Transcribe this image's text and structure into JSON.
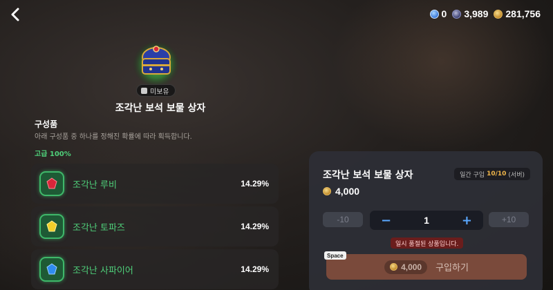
{
  "currency": {
    "items": [
      {
        "icon": "blue-gem-icon",
        "value": "0"
      },
      {
        "icon": "dark-gem-icon",
        "value": "3,989"
      },
      {
        "icon": "gold-coin-icon",
        "value": "281,756"
      }
    ]
  },
  "item": {
    "ownership_tag": "미보유",
    "title": "조각난 보석 보물 상자"
  },
  "contents": {
    "title": "구성품",
    "description": "아래 구성품 중 하나를 정해진 확률에 따라 획득합니다.",
    "grade_label": "고급 100%",
    "rewards": [
      {
        "name": "조각난 루비",
        "percent": "14.29%",
        "gem_color": "#d8263a"
      },
      {
        "name": "조각난 토파즈",
        "percent": "14.29%",
        "gem_color": "#f0d02a"
      },
      {
        "name": "조각난 사파이어",
        "percent": "14.29%",
        "gem_color": "#2f8cf0"
      }
    ]
  },
  "purchase": {
    "title": "조각난 보석 보물 상자",
    "limit_prefix": "일간 구입",
    "limit_value": "10/10",
    "limit_suffix": "(서버)",
    "price": "4,000",
    "minus_ten": "-10",
    "plus_ten": "+10",
    "minus": "−",
    "plus": "+",
    "quantity": "1",
    "soldout_message": "일시 품절된 상품입니다.",
    "shortcut_key": "Space",
    "buy_price": "4,000",
    "buy_label": "구입하기"
  },
  "colors": {
    "accent_green": "#4fd07a",
    "accent_blue": "#5aa8ff",
    "buy_button": "#7a4a3b",
    "limit_highlight": "#f0b64a"
  }
}
